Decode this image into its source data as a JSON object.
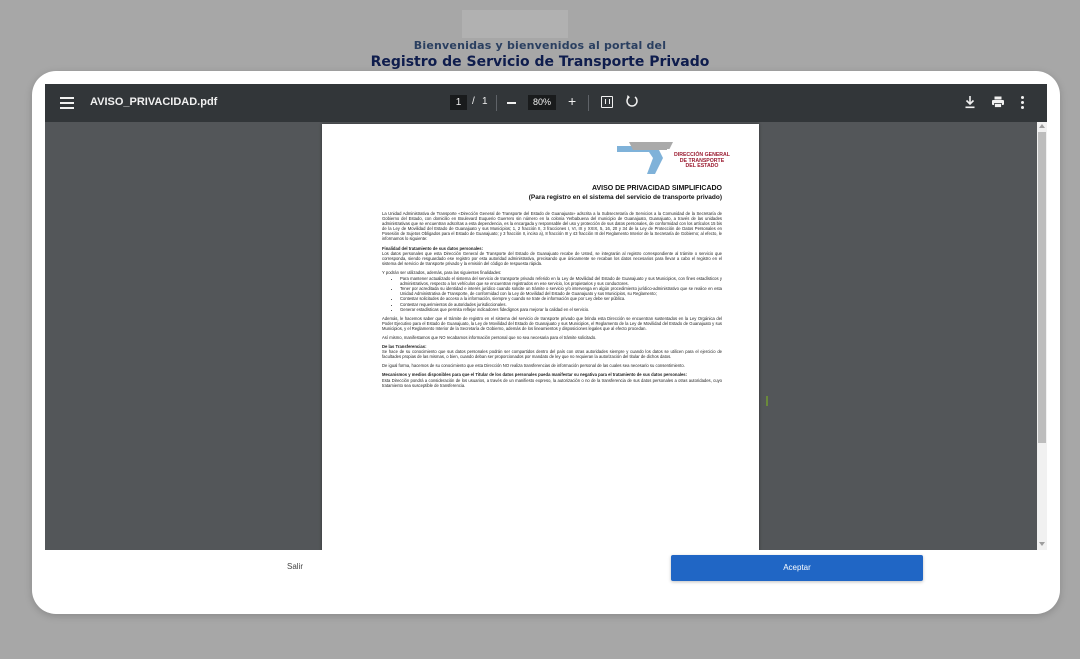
{
  "header": {
    "line1": "Bienvenidas y bienvenidos al portal del",
    "line2": "Registro de Servicio de Transporte Privado"
  },
  "viewer": {
    "file_name": "AVISO_PRIVACIDAD.pdf",
    "current_page": "1",
    "page_separator": "/",
    "total_pages": "1",
    "zoom": "80%",
    "icons": [
      "menu-icon",
      "zoom-out-icon",
      "zoom-in-icon",
      "fit-page-icon",
      "rotate-icon",
      "download-icon",
      "print-icon",
      "more-vert-icon"
    ]
  },
  "document": {
    "logo_text": [
      "DIRECCIÓN GENERAL",
      "DE TRANSPORTE",
      "DEL ESTADO"
    ],
    "title": "AVISO DE PRIVACIDAD SIMPLIFICADO",
    "subtitle": "(Para registro en el sistema del servicio de transporte privado)",
    "intro": "La Unidad Administrativa de Transporte «Dirección General de Transporte del Estado de Guanajuato» adscrita a la Subsecretaría de Servicios a la Comunidad de la Secretaría de Gobierno del Estado, con domicilio en Boulevard Euquerio Guerrero sin número en la colonia Yerbabuena del municipio de Guanajuato, Guanajuato, a través de las unidades administrativas que se encuentran adscritas a esta dependencia, es la encargada y responsable del uso y protección de sus datos personales, de conformidad con los artículos 15 bis de la Ley de Movilidad del Estado de Guanajuato y sus Municipios; 1, 2 fracción II, 3 fracciones I, VI, IX y XXIX, 5, 16, 20 y 34 de la Ley de Protección de Datos Personales en Posesión de Sujetos Obligados para el Estado de Guanajuato; y 3 fracción II, inciso a), 8 fracción III y 43 fracción III del Reglamento Interior de la Secretaría de Gobierno; al efecto, le informamos lo siguiente:",
    "purpose_heading": "Finalidad del tratamiento de sus datos personales:",
    "purpose_text": "Los datos personales que esta Dirección General de Transporte del Estado de Guanajuato recabe de Usted, se integrarán al registro correspondiente al trámite o servicio que corresponda, siendo resguardado ese registro por esta autoridad administrativa, precisando que únicamente se recaban los datos necesarios para llevar a cabo el registro en el sistema del servicio de transporte privado y la emisión del código de respuesta rápida.",
    "uses_intro": "Y podrán ser utilizados, además, para las siguientes finalidades:",
    "uses": [
      "Para mantener actualizado el sistema del servicio de transporte privado referido en la Ley de Movilidad del Estado de Guanajuato y sus Municipios, con fines estadísticos y administrativos, respecto a los vehículos que se encuentran registrados en ese servicio, los propietarios y sus conductores.",
      "Tener por acreditada su identidad e interés jurídico cuando solicite un trámite o servicio y/o intervenga en algún procedimiento jurídico-administrativo que se realice en esta Unidad Administrativa de Transporte, de conformidad con la Ley de Movilidad del Estado de Guanajuato y sus Municipios, su Reglamento;",
      "Contestar solicitudes de acceso a la información, siempre y cuando se trate de información que por Ley debe ser pública.",
      "Contestar requerimientos de autoridades jurisdiccionales.",
      "Generar estadísticas que permita reflejar indicadores fidedignos para mejorar la calidad en el servicio."
    ],
    "legal_text": "Además, le hacemos saber que el trámite de registro en el sistema del servicio de transporte privado que brinda esta Dirección se encuentran sustentados en la Ley Orgánica del Poder Ejecutivo para el Estado de Guanajuato, la Ley de Movilidad del Estado de Guanajuato y sus Municipios, el Reglamento de la Ley de Movilidad del Estado de Guanajuato y sus Municipios, y el Reglamento Interior de la Secretaría de Gobierno, además de los lineamientos y disposiciones legales que al efecto procedan.",
    "no_extra_data": "Así mismo, manifestamos que NO recabamos información personal que no sea necesaria para el trámite solicitado.",
    "transfers_heading": "De las Transferencias:",
    "transfers_text": "Se hace de su conocimiento que sus datos personales podrán ser compartidos dentro del país con otras autoridades siempre y cuando los datos se utilicen para el ejercicio de facultades propias de las mismas, o bien, cuando deban ser proporcionados por mandato de ley que no requieran la autorización del titular de dichos datos.",
    "no_transfers": "De igual forma, hacemos de su conocimiento que esta Dirección NO realiza transferencias de información personal de las cuales sea necesario su consentimiento.",
    "mechanisms_heading": "Mecanismos y medios disponibles para que el Titular de los datos personales pueda manifestar su negativa para el tratamiento de sus datos personales:",
    "mechanisms_text": "Esta Dirección pondrá a consideración de los usuarios, a través de un manifiesto expreso, la autorización o no de la transferencia de sus datos personales a otras autoridades, cuyo tratamiento sea susceptible de transferencia."
  },
  "actions": {
    "exit_label": "Salir",
    "accept_label": "Aceptar"
  },
  "colors": {
    "accent": "#2066c5",
    "toolbar": "#323639",
    "viewer_bg": "#535659",
    "header_text": "#0f1d4d"
  }
}
